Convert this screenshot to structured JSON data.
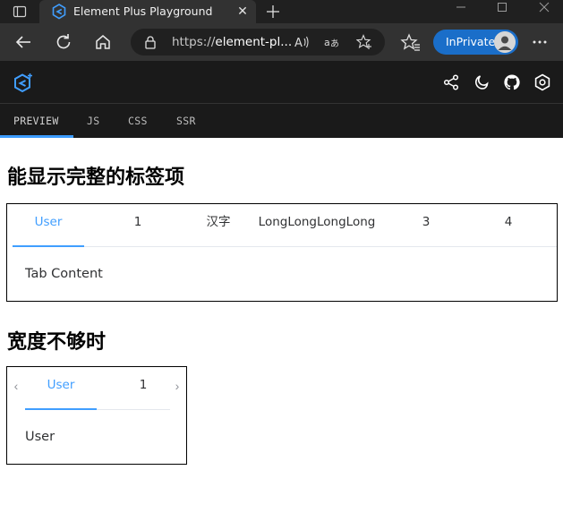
{
  "browser": {
    "tab_title": "Element Plus Playground",
    "url_scheme": "https://",
    "url_host": "element-pl...",
    "inprivate_label": "InPrivate"
  },
  "playground": {
    "tabs": [
      {
        "label": "PREVIEW"
      },
      {
        "label": "JS"
      },
      {
        "label": "CSS"
      },
      {
        "label": "SSR"
      }
    ],
    "active_tab": "PREVIEW"
  },
  "preview": {
    "section1": {
      "title": "能显示完整的标签项",
      "tabs": [
        {
          "label": "User"
        },
        {
          "label": "1"
        },
        {
          "label": "汉字"
        },
        {
          "label": "LongLongLongLong"
        },
        {
          "label": "3"
        },
        {
          "label": "4"
        }
      ],
      "active_tab": "User",
      "content": "Tab Content"
    },
    "section2": {
      "title": "宽度不够时",
      "tabs": [
        {
          "label": "User"
        },
        {
          "label": "1"
        }
      ],
      "active_tab": "User",
      "content": "User"
    }
  },
  "colors": {
    "accent": "#409eff",
    "playground_accent": "#3c9cff",
    "inprivate_badge": "#1a6ec9",
    "titlebar_bg": "#202020",
    "toolbar_bg": "#323232",
    "header_bg": "#1a1a1a"
  }
}
